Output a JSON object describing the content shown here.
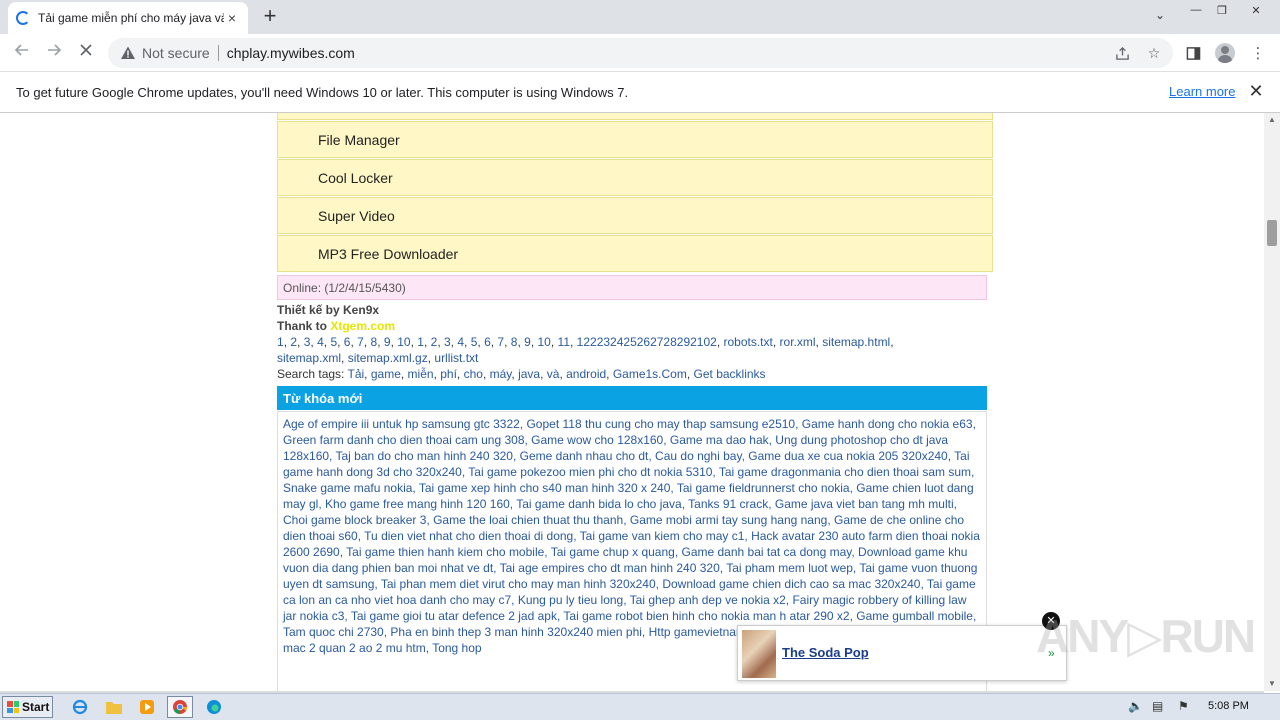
{
  "browser": {
    "tab_title": "Tải game miễn phí cho máy java và a",
    "tab_close": "×",
    "new_tab": "+",
    "address_not_secure": "Not secure",
    "address_url": "chplay.mywibes.com",
    "window_controls": [
      "—",
      "❐",
      "✕"
    ],
    "colors": {
      "accent": "#1a73e8",
      "tabbar": "#dee1e6"
    }
  },
  "infobar": {
    "message": "To get future Google Chrome updates, you'll need Windows 10 or later. This computer is using Windows 7.",
    "learn_more": "Learn more",
    "close": "✕"
  },
  "page": {
    "menu_items": [
      "File Manager",
      "Cool Locker",
      "Super Video",
      "MP3 Free Downloader"
    ],
    "online_text": "Online: (1/2/4/15/5430)",
    "designer": "Thiết kế by Ken9x",
    "thanks_prefix": "Thank to ",
    "thanks_link": "Xtgem.com",
    "page_links": [
      "1",
      "2",
      "3",
      "4",
      "5",
      "6",
      "7",
      "8",
      "9",
      "10",
      "1",
      "2",
      "3",
      "4",
      "5",
      "6",
      "7",
      "8",
      "9",
      "10",
      "11"
    ],
    "page_long": "122232425262728292102",
    "sitemap_links": [
      "robots.txt",
      "ror.xml",
      "sitemap.html",
      "sitemap.xml",
      "sitemap.xml.gz",
      "urllist.txt"
    ],
    "search_tags_label": "Search tags: ",
    "search_tags": [
      "Tải",
      "game",
      "miễn",
      "phí",
      "cho",
      "máy",
      "java",
      "và",
      "android",
      "Game1s.Com",
      "Get backlinks"
    ],
    "keywords_header": "Từ khóa mới",
    "keywords_text": "Age of empire iii untuk hp samsung gtc 3322, Gopet 118 thu cung cho may thap samsung e2510, Game hanh dong cho nokia e63, Green farm danh cho dien thoai cam ung 308, Game wow cho 128x160, Game ma dao hak, Ung dung photoshop cho dt java 128x160, Taj ban do cho man hinh 240 320, Geme danh nhau cho dt, Cau do nghi bay, Game dua xe cua nokia 205 320x240, Tai game hanh dong 3d cho 320x240, Tai game pokezoo mien phi cho dt nokia 5310, Tai game dragonmania cho dien thoai sam sum, Snake game mafu nokia, Tai game xep hinh cho s40 man hinh 320 x 240, Tai game fieldrunnerst cho nokia, Game chien luot dang may gl, Kho game free mang hinh 120 160, Tai game danh bida lo cho java, Tanks 91 crack, Game java viet ban tang mh multi, Choi game block breaker 3, Game the loai chien thuat thu thanh, Game mobi armi tay sung hang nang, Game de che online cho dien thoai s60, Tu dien viet nhat cho dien thoai di dong, Tai game van kiem cho may c1, Hack avatar 230 auto farm dien thoai nokia 2600 2690, Tai game thien hanh kiem cho mobile, Tai game chup x quang, Game danh bai tat ca dong may, Download game khu vuon dia dang phien ban moi nhat ve dt, Tai age empires cho dt man hinh 240 320, Tai pham mem luot wep, Tai game vuon thuong uyen dt samsung, Tai phan mem diet virut cho may man hinh 320x240, Download game chien dich cao sa mac 320x240, Tai game ca lon an ca nho viet hoa danh cho may c7, Kung pu ly tieu long, Tai ghep anh dep ve nokia x2, Fairy magic robbery of killing law jar nokia c3, Tai game gioi tu                                    atar defence 2 jad apk, Tai game robot bien hinh cho nokia man h                                    atar 290 x2, Game gumball mobile, Tam quoc chi 2730, Pha                                    en binh thep 3 man hinh 320x240 mien phi, Http gamevietnam vn avatar giai thich mien tuong deo 2 canh mac 2 quan 2 ao 2 mu htm, Tong hop"
  },
  "ad": {
    "title": "The Soda Pop",
    "arrow": "»",
    "close": "✕"
  },
  "watermark": "ANY▷RUN",
  "taskbar": {
    "start_label": "Start",
    "clock": "5:08 PM"
  }
}
